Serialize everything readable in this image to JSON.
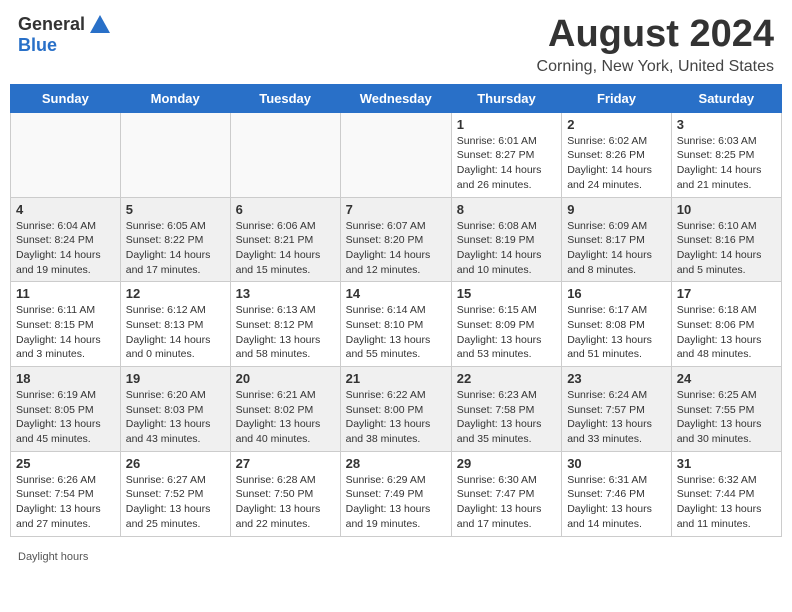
{
  "header": {
    "logo_general": "General",
    "logo_blue": "Blue",
    "month_title": "August 2024",
    "location": "Corning, New York, United States"
  },
  "days_of_week": [
    "Sunday",
    "Monday",
    "Tuesday",
    "Wednesday",
    "Thursday",
    "Friday",
    "Saturday"
  ],
  "legend": {
    "daylight_hours": "Daylight hours"
  },
  "weeks": [
    {
      "alt": false,
      "days": [
        {
          "num": "",
          "info": ""
        },
        {
          "num": "",
          "info": ""
        },
        {
          "num": "",
          "info": ""
        },
        {
          "num": "",
          "info": ""
        },
        {
          "num": "1",
          "info": "Sunrise: 6:01 AM\nSunset: 8:27 PM\nDaylight: 14 hours and 26 minutes."
        },
        {
          "num": "2",
          "info": "Sunrise: 6:02 AM\nSunset: 8:26 PM\nDaylight: 14 hours and 24 minutes."
        },
        {
          "num": "3",
          "info": "Sunrise: 6:03 AM\nSunset: 8:25 PM\nDaylight: 14 hours and 21 minutes."
        }
      ]
    },
    {
      "alt": true,
      "days": [
        {
          "num": "4",
          "info": "Sunrise: 6:04 AM\nSunset: 8:24 PM\nDaylight: 14 hours and 19 minutes."
        },
        {
          "num": "5",
          "info": "Sunrise: 6:05 AM\nSunset: 8:22 PM\nDaylight: 14 hours and 17 minutes."
        },
        {
          "num": "6",
          "info": "Sunrise: 6:06 AM\nSunset: 8:21 PM\nDaylight: 14 hours and 15 minutes."
        },
        {
          "num": "7",
          "info": "Sunrise: 6:07 AM\nSunset: 8:20 PM\nDaylight: 14 hours and 12 minutes."
        },
        {
          "num": "8",
          "info": "Sunrise: 6:08 AM\nSunset: 8:19 PM\nDaylight: 14 hours and 10 minutes."
        },
        {
          "num": "9",
          "info": "Sunrise: 6:09 AM\nSunset: 8:17 PM\nDaylight: 14 hours and 8 minutes."
        },
        {
          "num": "10",
          "info": "Sunrise: 6:10 AM\nSunset: 8:16 PM\nDaylight: 14 hours and 5 minutes."
        }
      ]
    },
    {
      "alt": false,
      "days": [
        {
          "num": "11",
          "info": "Sunrise: 6:11 AM\nSunset: 8:15 PM\nDaylight: 14 hours and 3 minutes."
        },
        {
          "num": "12",
          "info": "Sunrise: 6:12 AM\nSunset: 8:13 PM\nDaylight: 14 hours and 0 minutes."
        },
        {
          "num": "13",
          "info": "Sunrise: 6:13 AM\nSunset: 8:12 PM\nDaylight: 13 hours and 58 minutes."
        },
        {
          "num": "14",
          "info": "Sunrise: 6:14 AM\nSunset: 8:10 PM\nDaylight: 13 hours and 55 minutes."
        },
        {
          "num": "15",
          "info": "Sunrise: 6:15 AM\nSunset: 8:09 PM\nDaylight: 13 hours and 53 minutes."
        },
        {
          "num": "16",
          "info": "Sunrise: 6:17 AM\nSunset: 8:08 PM\nDaylight: 13 hours and 51 minutes."
        },
        {
          "num": "17",
          "info": "Sunrise: 6:18 AM\nSunset: 8:06 PM\nDaylight: 13 hours and 48 minutes."
        }
      ]
    },
    {
      "alt": true,
      "days": [
        {
          "num": "18",
          "info": "Sunrise: 6:19 AM\nSunset: 8:05 PM\nDaylight: 13 hours and 45 minutes."
        },
        {
          "num": "19",
          "info": "Sunrise: 6:20 AM\nSunset: 8:03 PM\nDaylight: 13 hours and 43 minutes."
        },
        {
          "num": "20",
          "info": "Sunrise: 6:21 AM\nSunset: 8:02 PM\nDaylight: 13 hours and 40 minutes."
        },
        {
          "num": "21",
          "info": "Sunrise: 6:22 AM\nSunset: 8:00 PM\nDaylight: 13 hours and 38 minutes."
        },
        {
          "num": "22",
          "info": "Sunrise: 6:23 AM\nSunset: 7:58 PM\nDaylight: 13 hours and 35 minutes."
        },
        {
          "num": "23",
          "info": "Sunrise: 6:24 AM\nSunset: 7:57 PM\nDaylight: 13 hours and 33 minutes."
        },
        {
          "num": "24",
          "info": "Sunrise: 6:25 AM\nSunset: 7:55 PM\nDaylight: 13 hours and 30 minutes."
        }
      ]
    },
    {
      "alt": false,
      "days": [
        {
          "num": "25",
          "info": "Sunrise: 6:26 AM\nSunset: 7:54 PM\nDaylight: 13 hours and 27 minutes."
        },
        {
          "num": "26",
          "info": "Sunrise: 6:27 AM\nSunset: 7:52 PM\nDaylight: 13 hours and 25 minutes."
        },
        {
          "num": "27",
          "info": "Sunrise: 6:28 AM\nSunset: 7:50 PM\nDaylight: 13 hours and 22 minutes."
        },
        {
          "num": "28",
          "info": "Sunrise: 6:29 AM\nSunset: 7:49 PM\nDaylight: 13 hours and 19 minutes."
        },
        {
          "num": "29",
          "info": "Sunrise: 6:30 AM\nSunset: 7:47 PM\nDaylight: 13 hours and 17 minutes."
        },
        {
          "num": "30",
          "info": "Sunrise: 6:31 AM\nSunset: 7:46 PM\nDaylight: 13 hours and 14 minutes."
        },
        {
          "num": "31",
          "info": "Sunrise: 6:32 AM\nSunset: 7:44 PM\nDaylight: 13 hours and 11 minutes."
        }
      ]
    }
  ]
}
